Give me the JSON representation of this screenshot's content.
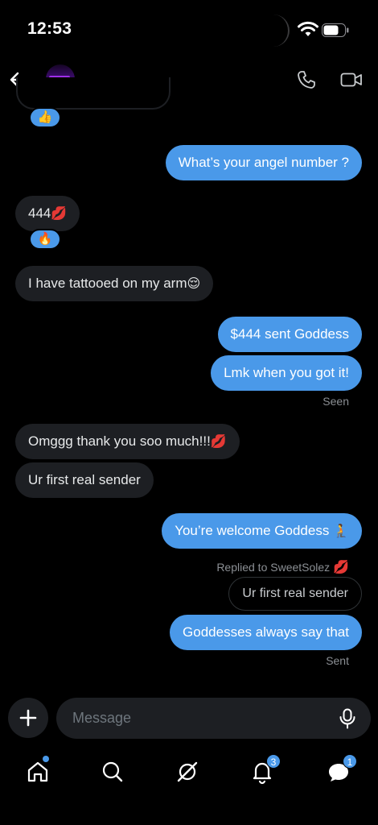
{
  "status_bar": {
    "time": "12:53"
  },
  "header": {
    "back": "back",
    "avatar": "contact-avatar"
  },
  "messages": [
    {
      "side": "in",
      "text": "444",
      "emoji": "💋",
      "reaction": "🔥"
    },
    {
      "side": "out",
      "text": "What’s your angel number ?"
    },
    {
      "side": "in",
      "text": "I have tattooed on my arm",
      "emoji": "😌"
    },
    {
      "side": "out",
      "text": "$444 sent Goddess"
    },
    {
      "side": "out",
      "text": "Lmk when you got it!"
    },
    {
      "side": "in",
      "text": "Omggg thank you soo much!!!",
      "emoji": "💋"
    },
    {
      "side": "in",
      "text": "Ur first real sender"
    },
    {
      "side": "out",
      "text": "You’re welcome Goddess",
      "emoji": "🧎"
    },
    {
      "side": "out",
      "text": "Goddesses always say that"
    }
  ],
  "top_reaction": "👍",
  "seen_label": "Seen",
  "sent_label": "Sent",
  "reply_context": {
    "label": "Replied to SweetSolez",
    "emoji": "💋",
    "quoted_text": "Ur first real sender"
  },
  "composer": {
    "placeholder": "Message"
  },
  "nav": {
    "notifications_badge": "3",
    "messages_badge": "1"
  },
  "colors": {
    "accent": "#4a99e9",
    "incoming_bubble": "#1d1f23",
    "background": "#000000"
  }
}
